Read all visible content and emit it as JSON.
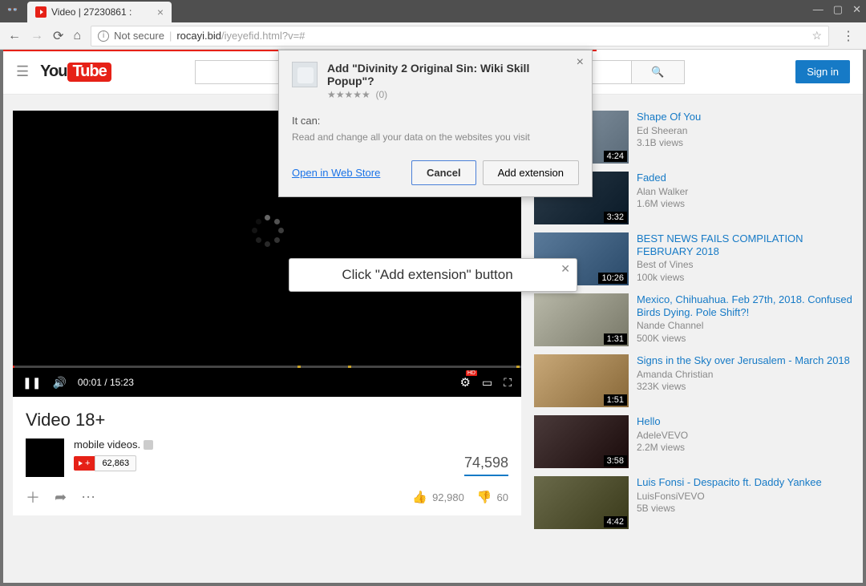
{
  "window": {
    "tab_title": "Video | 27230861 :",
    "controls": {
      "min": "—",
      "max": "▢",
      "close": "✕"
    }
  },
  "browser": {
    "not_secure_label": "Not secure",
    "url_host": "rocayi.bid",
    "url_path": "/iyeyefid.html?v=#"
  },
  "yt": {
    "logo_you": "You",
    "logo_tube": "Tube",
    "search_placeholder": "",
    "signin": "Sign in"
  },
  "player": {
    "time_current": "00:01",
    "time_total": "15:23",
    "hd_badge": "HD"
  },
  "video": {
    "title": "Video 18+",
    "channel": "mobile videos.",
    "sub_plus": "+",
    "sub_count": "62,863",
    "views": "74,598",
    "likes": "92,980",
    "dislikes": "60"
  },
  "sidebar": [
    {
      "title": "Shape Of You",
      "channel": "Ed Sheeran",
      "views": "3.1B views",
      "dur": "4:24"
    },
    {
      "title": "Faded",
      "channel": "Alan Walker",
      "views": "1.6M views",
      "dur": "3:32"
    },
    {
      "title": "BEST NEWS FAILS COMPILATION FEBRUARY 2018",
      "channel": "Best of Vines",
      "views": "100k views",
      "dur": "10:26"
    },
    {
      "title": "Mexico, Chihuahua. Feb 27th, 2018. Confused Birds Dying. Pole Shift?!",
      "channel": "Nande Channel",
      "views": "500K views",
      "dur": "1:31"
    },
    {
      "title": "Signs in the Sky over Jerusalem - March 2018",
      "channel": "Amanda Christian",
      "views": "323K views",
      "dur": "1:51"
    },
    {
      "title": "Hello",
      "channel": "AdeleVEVO",
      "views": "2.2M views",
      "dur": "3:58"
    },
    {
      "title": "Luis Fonsi - Despacito ft. Daddy Yankee",
      "channel": "LuisFonsiVEVO",
      "views": "5B views",
      "dur": "4:42"
    }
  ],
  "ext": {
    "title": "Add \"Divinity 2 Original Sin: Wiki Skill Popup\"?",
    "rating_count": "(0)",
    "it_can": "It can:",
    "permission": "Read and change all your data on the websites you visit",
    "webstore": "Open in Web Store",
    "cancel": "Cancel",
    "add": "Add extension"
  },
  "hint": {
    "text": "Click \"Add extension\" button"
  }
}
